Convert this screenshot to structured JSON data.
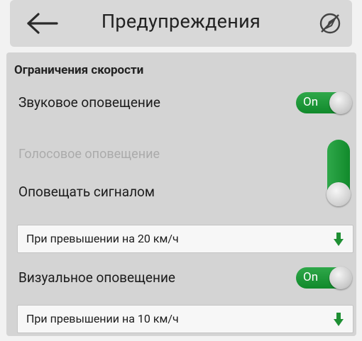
{
  "header": {
    "title": "Предупреждения",
    "back_icon": "arrow-left-icon",
    "gps_icon": "gps-off-icon"
  },
  "section": {
    "title": "Ограничения скорости"
  },
  "rows": {
    "sound_alert": {
      "label": "Звуковое оповещение",
      "switch": "On"
    },
    "voice_alert": {
      "label": "Голосовое оповещение"
    },
    "signal_alert": {
      "label": "Оповещать сигналом"
    },
    "visual_alert": {
      "label": "Визуальное оповещение",
      "switch": "On"
    }
  },
  "dropdowns": {
    "sound_threshold": "При превышении на 20 км/ч",
    "visual_threshold": "При превышении на 10 км/ч"
  },
  "colors": {
    "switch_green": "#1a9a36",
    "arrow_green": "#1e8f33"
  }
}
